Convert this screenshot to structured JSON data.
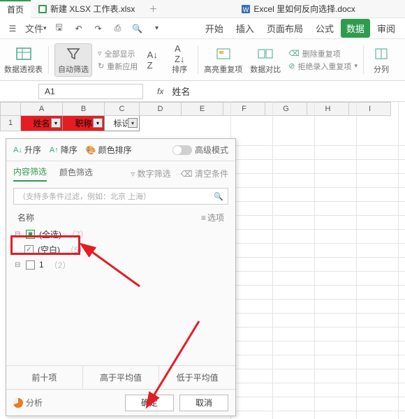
{
  "tabs": {
    "home": "首页",
    "file1": "新建 XLSX 工作表.xlsx",
    "file2": "Excel 里如何反向选择.docx"
  },
  "menu": {
    "file": "文件",
    "items": [
      "开始",
      "插入",
      "页面布局",
      "公式",
      "数据",
      "审阅"
    ],
    "active": "数据"
  },
  "ribbon": {
    "pivot": "数据透视表",
    "autofilter": "自动筛选",
    "showall": "全部显示",
    "reapply": "重新应用",
    "sort": "排序",
    "highlight": "高亮重复项",
    "compare": "数据对比",
    "deldup": "删除重复项",
    "rejdup": "拒绝录入重复项",
    "split": "分列"
  },
  "namebox": "A1",
  "fx": "fx",
  "formula_value": "姓名",
  "cols": [
    "A",
    "B",
    "C",
    "D",
    "E",
    "F",
    "G",
    "H",
    "I"
  ],
  "row1": {
    "num": "1",
    "a": "姓名",
    "b": "职称",
    "c": "标识"
  },
  "panel": {
    "asc": "升序",
    "desc": "降序",
    "colorSort": "颜色排序",
    "adv": "高级模式",
    "tabContent": "内容筛选",
    "tabColor": "颜色筛选",
    "tabNumber": "数字筛选",
    "clear": "清空条件",
    "searchPlaceholder": "（支持多条件过滤，例如：北京  上海）",
    "name": "名称",
    "options": "选项",
    "items": [
      {
        "label": "(全选)",
        "count": "（7）",
        "state": "partial"
      },
      {
        "label": "(空白)",
        "count": "（5）",
        "state": "checked"
      },
      {
        "label": "1",
        "count": "（2）",
        "state": "unchecked"
      }
    ],
    "top10": "前十项",
    "aboveAvg": "高于平均值",
    "belowAvg": "低于平均值",
    "analysis": "分析",
    "ok": "确定",
    "cancel": "取消"
  }
}
